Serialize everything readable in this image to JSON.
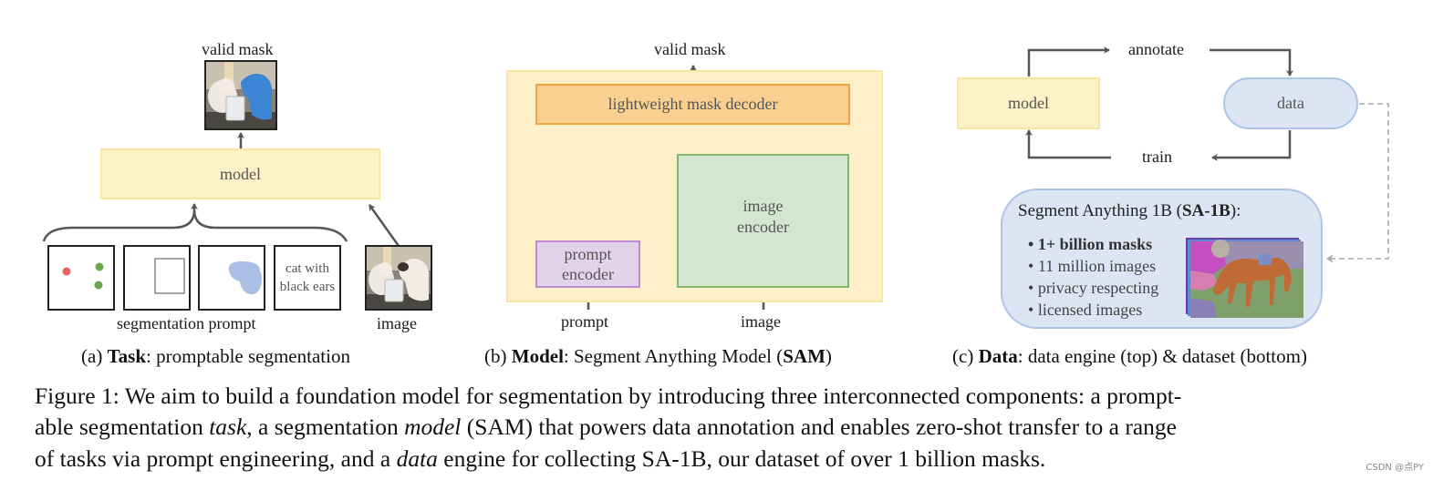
{
  "panel_a": {
    "output_label": "valid mask",
    "model_label": "model",
    "text_prompt_line1": "cat with",
    "text_prompt_line2": "black ears",
    "prompt_group_label": "segmentation prompt",
    "image_label": "image",
    "prompt_types": [
      "points",
      "box",
      "mask",
      "text"
    ],
    "colors": {
      "model_fill": "#fdf1c8",
      "model_border": "#fbe6a3",
      "point_negative": "#e06666",
      "point_positive": "#6aa84f",
      "mask_blob": "#a9bfe6"
    },
    "subcaption_prefix": "(a) ",
    "subcaption_bold": "Task",
    "subcaption_rest": ": promptable segmentation"
  },
  "panel_b": {
    "output_label": "valid mask",
    "decoder_label": "lightweight mask decoder",
    "prompt_encoder_label_1": "prompt",
    "prompt_encoder_label_2": "encoder",
    "image_encoder_label_1": "image",
    "image_encoder_label_2": "encoder",
    "prompt_input": "prompt",
    "image_input": "image",
    "colors": {
      "outer_fill": "#fdf0c8",
      "decoder_fill": "#f9d08f",
      "decoder_border": "#f4a340",
      "prompt_enc_fill": "#e3d3ea",
      "prompt_enc_border": "#c08ad6",
      "image_enc_fill": "#d4e6d1",
      "image_enc_border": "#82b86c"
    },
    "subcaption_prefix": "(b) ",
    "subcaption_bold": "Model",
    "subcaption_mid": ": Segment Anything Model (",
    "subcaption_bold2": "SAM",
    "subcaption_end": ")"
  },
  "panel_c": {
    "annotate_label": "annotate",
    "train_label": "train",
    "model_label": "model",
    "data_label": "data",
    "dataset_title_prefix": "Segment Anything 1B (",
    "dataset_title_bold": "SA-1B",
    "dataset_title_suffix": "):",
    "bullets": [
      "1+ billion masks",
      "11 million images",
      "privacy respecting",
      "licensed images"
    ],
    "colors": {
      "model_fill": "#fdf1c8",
      "data_fill": "#dbe5f4",
      "data_border": "#aec4e6"
    },
    "subcaption_prefix": "(c) ",
    "subcaption_bold": "Data",
    "subcaption_rest": ": data engine (top) & dataset (bottom)"
  },
  "caption": {
    "line1": "Figure 1: We aim to build a foundation model for segmentation by introducing three interconnected components: a prompt-",
    "line2_a": "able segmentation ",
    "line2_task": "task",
    "line2_b": ", a segmentation ",
    "line2_model": "model",
    "line2_c": " (SAM) that powers data annotation and enables zero-shot transfer to a range",
    "line3_a": "of tasks via prompt engineering, and a ",
    "line3_data": "data",
    "line3_b": " engine for collecting SA-1B, our dataset of over 1 billion masks."
  },
  "watermark": "CSDN @点PY"
}
